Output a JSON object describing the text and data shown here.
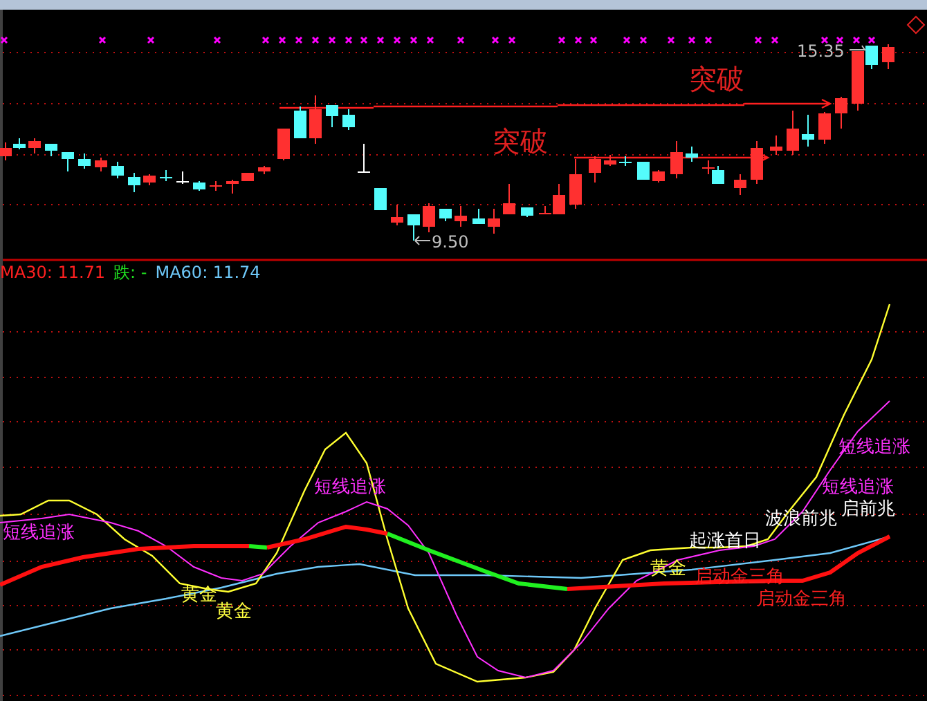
{
  "price_panel": {
    "annotations": [
      {
        "kind": "breakout",
        "text": "突破"
      },
      {
        "kind": "breakout",
        "text": "突破"
      },
      {
        "kind": "high",
        "text": "15.35"
      },
      {
        "kind": "low",
        "text": "9.50"
      }
    ]
  },
  "legend": [
    {
      "label": "MA30:",
      "value": "11.71",
      "color": "#ff2020"
    },
    {
      "label": "跌:",
      "value": "-",
      "color": "#20e020"
    },
    {
      "label": "MA60:",
      "value": "11.74",
      "color": "#6ec8f8"
    }
  ],
  "indicator_panel": {
    "signals": [
      {
        "text": "短线追涨",
        "color": "#ff30ff"
      },
      {
        "text": "短线追涨",
        "color": "#ff30ff"
      },
      {
        "text": "短线追涨",
        "color": "#ff30ff"
      },
      {
        "text": "启前兆",
        "color": "#ffffff"
      },
      {
        "text": "波浪前兆",
        "color": "#ffffff"
      },
      {
        "text": "短线追涨",
        "color": "#ff30ff"
      },
      {
        "text": "起涨首日",
        "color": "#ffffff"
      },
      {
        "text": "黄金",
        "color": "#ffff40"
      },
      {
        "text": "启动金三角",
        "color": "#ff2020"
      },
      {
        "text": "黄金",
        "color": "#ffff40"
      },
      {
        "text": "启动金三角",
        "color": "#ff2020"
      },
      {
        "text": "黄金",
        "color": "#ffff40"
      }
    ]
  }
}
